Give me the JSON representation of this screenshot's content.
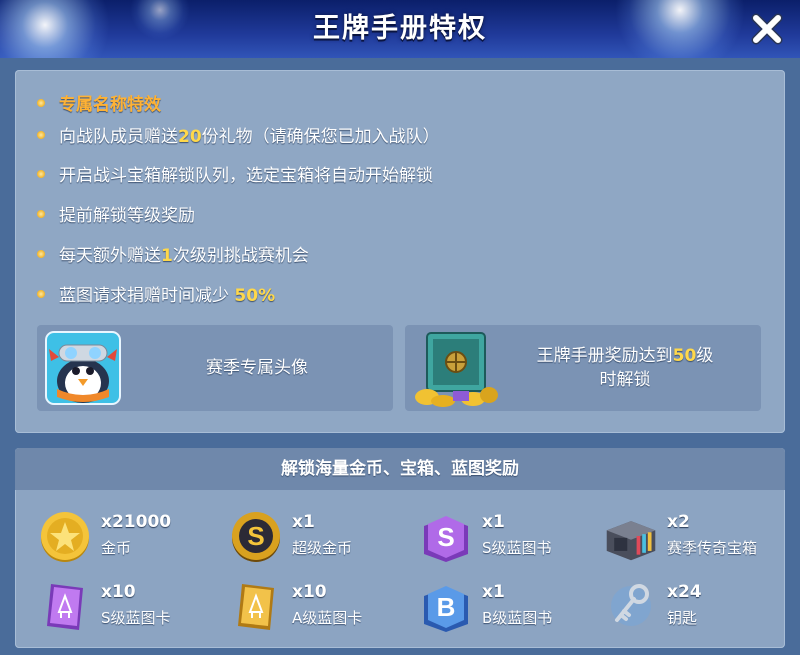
{
  "header": {
    "title": "王牌手册特权"
  },
  "perks": [
    {
      "text": "专属名称特效"
    },
    {
      "before": "向战队成员赠送",
      "highlight": "20",
      "after": "份礼物（请确保您已加入战队）"
    },
    {
      "text": "开启战斗宝箱解锁队列，选定宝箱将自动开始解锁"
    },
    {
      "text": "提前解锁等级奖励"
    },
    {
      "before": "每天额外赠送",
      "highlight": "1",
      "after": "次级别挑战赛机会"
    },
    {
      "before": "蓝图请求捐赠时间减少 ",
      "highlight": "50%",
      "after": ""
    }
  ],
  "cards": [
    {
      "label": "赛季专属头像",
      "icon": "penguin-avatar-icon"
    },
    {
      "line1_before": "王牌手册奖励达到",
      "line1_highlight": "50",
      "line1_after": "级",
      "line2": "时解锁",
      "icon": "safe-chest-icon"
    }
  ],
  "rewards_title": "解锁海量金币、宝箱、蓝图奖励",
  "rewards": [
    {
      "qty": "x21000",
      "name": "金币",
      "icon": "gold-coin-icon"
    },
    {
      "qty": "x1",
      "name": "超级金币",
      "icon": "super-coin-icon"
    },
    {
      "qty": "x1",
      "name": "S级蓝图书",
      "icon": "s-blueprint-book-icon"
    },
    {
      "qty": "x2",
      "name": "赛季传奇宝箱",
      "icon": "legendary-chest-icon"
    },
    {
      "qty": "x10",
      "name": "S级蓝图卡",
      "icon": "s-blueprint-card-icon"
    },
    {
      "qty": "x10",
      "name": "A级蓝图卡",
      "icon": "a-blueprint-card-icon"
    },
    {
      "qty": "x1",
      "name": "B级蓝图书",
      "icon": "b-blueprint-book-icon"
    },
    {
      "qty": "x24",
      "name": "钥匙",
      "icon": "key-icon"
    }
  ],
  "colors": {
    "highlight": "#ffd84a",
    "first_perk": "#ffb234",
    "panel": "#8fa7c4",
    "header": "#203a9a"
  }
}
